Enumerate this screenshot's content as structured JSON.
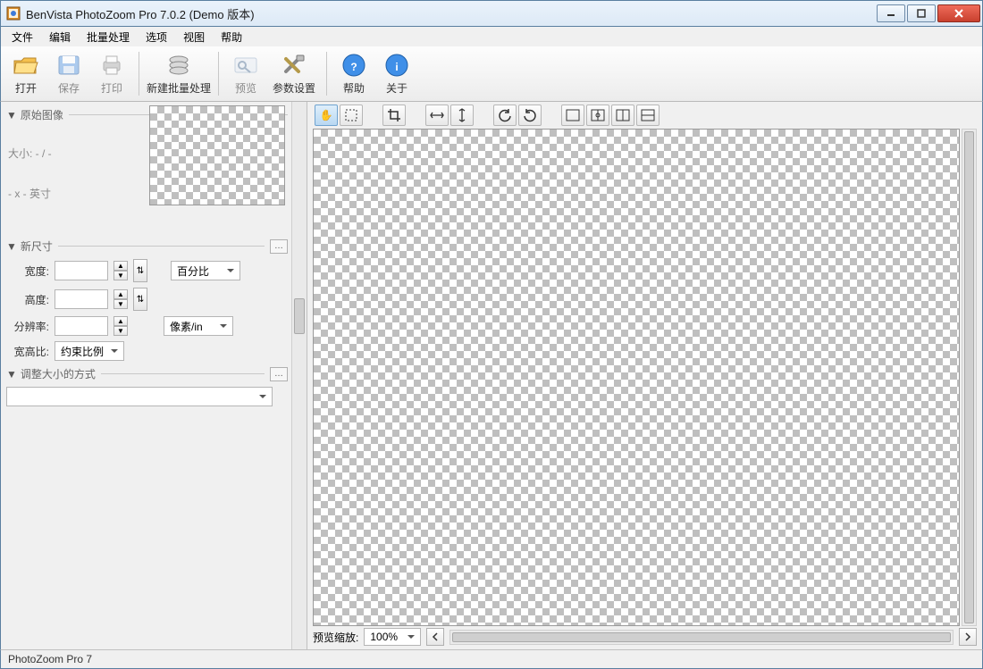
{
  "window": {
    "title": "BenVista PhotoZoom Pro 7.0.2 (Demo 版本)"
  },
  "menu": {
    "file": "文件",
    "edit": "编辑",
    "batch": "批量处理",
    "options": "选项",
    "view": "视图",
    "help": "帮助"
  },
  "toolbar": {
    "open": "打开",
    "save": "保存",
    "print": "打印",
    "new_batch": "新建批量处理",
    "preview": "预览",
    "settings": "参数设置",
    "help": "帮助",
    "about": "关于"
  },
  "left": {
    "original_header": "原始图像",
    "size_label": "大小: - / -",
    "dpi_label": "- x - 英寸",
    "newsize_header": "新尺寸",
    "width_label": "宽度:",
    "height_label": "高度:",
    "res_label": "分辨率:",
    "aspect_label": "宽高比:",
    "unit_percent": "百分比",
    "unit_pixels_in": "像素/in",
    "aspect_value": "约束比例",
    "resize_method_header": "调整大小的方式",
    "width_value": "",
    "height_value": "",
    "res_value": "",
    "method_value": ""
  },
  "canvas": {
    "zoom_label": "预览缩放:",
    "zoom_value": "100%"
  },
  "status": {
    "text": "PhotoZoom Pro 7"
  }
}
